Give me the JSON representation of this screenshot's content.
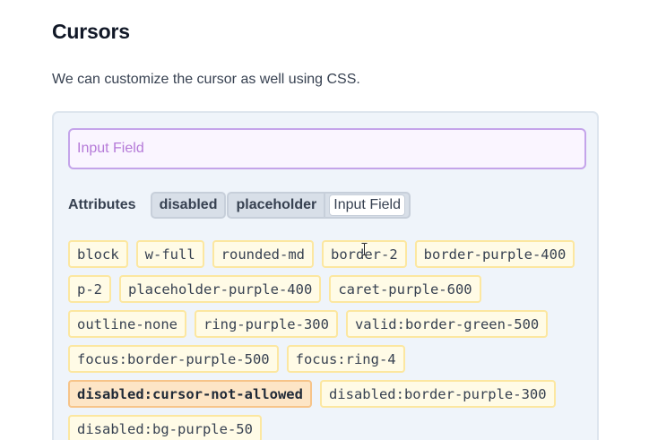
{
  "section": {
    "title": "Cursors",
    "description": "We can customize the cursor as well using CSS."
  },
  "demo": {
    "input": {
      "placeholder": "Input Field",
      "value": ""
    },
    "attributes": {
      "label": "Attributes",
      "disabled": "disabled",
      "placeholder_name": "placeholder",
      "placeholder_value": "Input Field"
    },
    "class_rows": [
      [
        "block",
        "w-full",
        "rounded-md",
        "border-2",
        "border-purple-400"
      ],
      [
        "p-2",
        "placeholder-purple-400",
        "caret-purple-600"
      ],
      [
        "outline-none",
        "ring-purple-300",
        "valid:border-green-500"
      ],
      [
        "focus:border-purple-500",
        "focus:ring-4"
      ],
      [
        "disabled:cursor-not-allowed",
        "disabled:border-purple-300"
      ],
      [
        "disabled:bg-purple-50"
      ]
    ],
    "highlighted_class": "disabled:cursor-not-allowed"
  },
  "colors": {
    "panel_bg": "#eff4fa",
    "input_border": "#c4a4ea",
    "input_bg": "#faf5ff",
    "placeholder": "#b57ad8",
    "chip_bg": "#fffbe6",
    "chip_border": "#fce7a0",
    "highlight_bg": "#fde5c6",
    "highlight_border": "#f7c489"
  },
  "icons": {
    "cursor": "i-beam-text-cursor-icon"
  }
}
